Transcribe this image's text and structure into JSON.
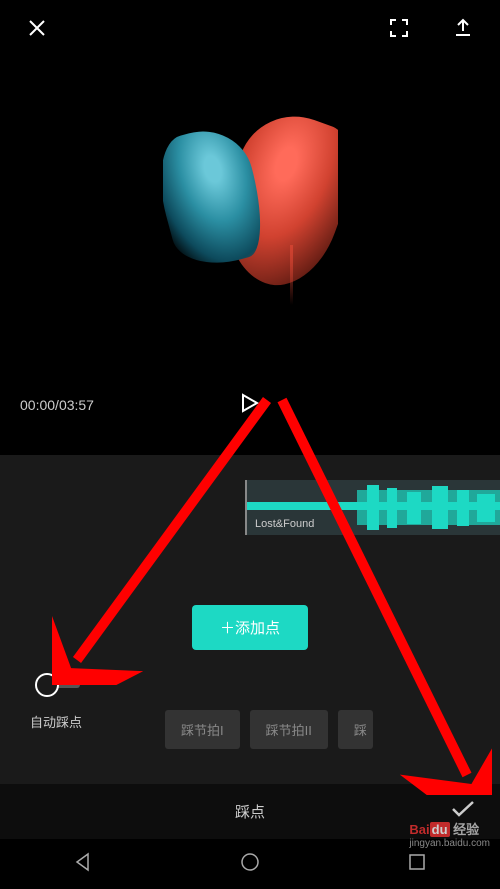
{
  "time": {
    "current": "00:00",
    "total": "03:57"
  },
  "audio": {
    "track_name": "Lost&Found"
  },
  "buttons": {
    "add_point": "＋添加点",
    "mode1": "踩节拍I",
    "mode2": "踩节拍II",
    "mode3": "踩"
  },
  "toggle": {
    "label": "自动踩点"
  },
  "panel": {
    "title": "踩点"
  },
  "watermark": {
    "logo": "Baidu 经验",
    "url": "jingyan.baidu.com"
  }
}
